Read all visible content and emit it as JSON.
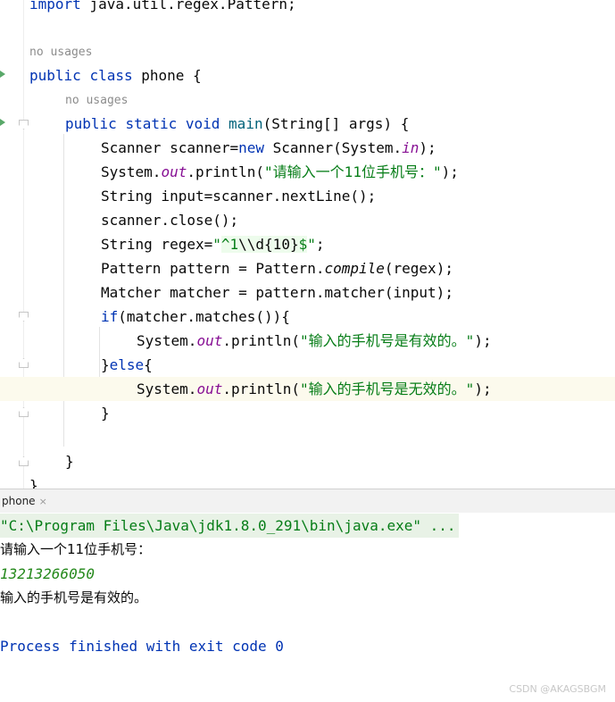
{
  "editor": {
    "lines": [
      {
        "id": "import",
        "parts": [
          {
            "t": "import ",
            "c": "kw"
          },
          {
            "t": "java.util.regex.Pattern;",
            "c": ""
          }
        ]
      },
      {
        "id": "hint1",
        "hint": "no usages"
      },
      {
        "id": "class",
        "parts": [
          {
            "t": "public ",
            "c": "kw"
          },
          {
            "t": "class ",
            "c": "kw"
          },
          {
            "t": "phone {",
            "c": ""
          }
        ]
      },
      {
        "id": "hint2",
        "hint": "no usages"
      },
      {
        "id": "main",
        "parts": [
          {
            "t": "public ",
            "c": "kw"
          },
          {
            "t": "static ",
            "c": "kw"
          },
          {
            "t": "void ",
            "c": "kw"
          },
          {
            "t": "main",
            "c": "fn"
          },
          {
            "t": "(String[] args) {",
            "c": ""
          }
        ]
      },
      {
        "id": "scanner",
        "parts": [
          {
            "t": "Scanner scanner=",
            "c": ""
          },
          {
            "t": "new ",
            "c": "kw"
          },
          {
            "t": "Scanner(System.",
            "c": ""
          },
          {
            "t": "in",
            "c": "fld"
          },
          {
            "t": ");",
            "c": ""
          }
        ]
      },
      {
        "id": "print1",
        "parts": [
          {
            "t": "System.",
            "c": ""
          },
          {
            "t": "out",
            "c": "fld"
          },
          {
            "t": ".println(",
            "c": ""
          },
          {
            "t": "\"请输入一个11位手机号：\"",
            "c": "str"
          },
          {
            "t": ");",
            "c": ""
          }
        ]
      },
      {
        "id": "input",
        "parts": [
          {
            "t": "String input=scanner.nextLine();",
            "c": ""
          }
        ]
      },
      {
        "id": "close",
        "parts": [
          {
            "t": "scanner.close();",
            "c": ""
          }
        ]
      },
      {
        "id": "regex",
        "parts": [
          {
            "t": "String regex=",
            "c": ""
          },
          {
            "t": "\"",
            "c": "str"
          },
          {
            "t": "^1",
            "c": "str regex"
          },
          {
            "t": "\\\\d",
            "c": "regex esc"
          },
          {
            "t": "{10}",
            "c": "regex esc"
          },
          {
            "t": "$",
            "c": "str regex"
          },
          {
            "t": "\"",
            "c": "str"
          },
          {
            "t": ";",
            "c": ""
          }
        ]
      },
      {
        "id": "pattern",
        "parts": [
          {
            "t": "Pattern pattern = Pattern.",
            "c": ""
          },
          {
            "t": "compile",
            "c": "stc"
          },
          {
            "t": "(regex);",
            "c": ""
          }
        ]
      },
      {
        "id": "matcher",
        "parts": [
          {
            "t": "Matcher matcher = pattern.matcher(input);",
            "c": ""
          }
        ]
      },
      {
        "id": "if",
        "parts": [
          {
            "t": "if",
            "c": "kw"
          },
          {
            "t": "(matcher.matches()){",
            "c": ""
          }
        ]
      },
      {
        "id": "print2",
        "parts": [
          {
            "t": "System.",
            "c": ""
          },
          {
            "t": "out",
            "c": "fld"
          },
          {
            "t": ".println(",
            "c": ""
          },
          {
            "t": "\"输入的手机号是有效的。\"",
            "c": "str"
          },
          {
            "t": ");",
            "c": ""
          }
        ]
      },
      {
        "id": "else",
        "parts": [
          {
            "t": "}",
            "c": ""
          },
          {
            "t": "else",
            "c": "kw"
          },
          {
            "t": "{",
            "c": ""
          }
        ]
      },
      {
        "id": "print3",
        "parts": [
          {
            "t": "System.",
            "c": ""
          },
          {
            "t": "out",
            "c": "fld"
          },
          {
            "t": ".println(",
            "c": ""
          },
          {
            "t": "\"输入的手机号是无效的。\"",
            "c": "str"
          },
          {
            "t": ");",
            "c": ""
          }
        ]
      },
      {
        "id": "close-if",
        "parts": [
          {
            "t": "}",
            "c": ""
          }
        ]
      },
      {
        "id": "blank",
        "parts": []
      },
      {
        "id": "close-main",
        "parts": [
          {
            "t": "}",
            "c": ""
          }
        ]
      },
      {
        "id": "close-class",
        "parts": [
          {
            "t": "}",
            "c": ""
          }
        ]
      }
    ]
  },
  "console": {
    "tab_label": "phone",
    "tab_close": "×",
    "command": "\"C:\\Program Files\\Java\\jdk1.8.0_291\\bin\\java.exe\" ...",
    "prompt": "请输入一个11位手机号：",
    "user_input": "13213266050",
    "output": "输入的手机号是有效的。",
    "finished": "Process finished with exit code 0"
  },
  "watermark": "CSDN @AKAGSBGM",
  "colors": {
    "keyword": "#0033b3",
    "string": "#067d17",
    "field": "#871094",
    "method": "#00627a",
    "highlight": "#fcfaed"
  }
}
